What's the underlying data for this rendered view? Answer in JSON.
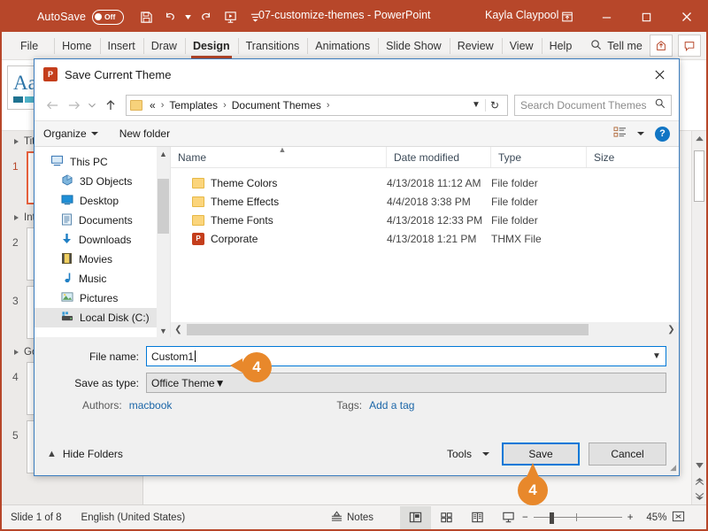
{
  "titlebar": {
    "autosave_label": "AutoSave",
    "autosave_state": "Off",
    "document_title": "07-customize-themes  -  PowerPoint",
    "user_name": "Kayla Claypool",
    "qat_icons": [
      "save-icon",
      "undo-icon",
      "redo-icon",
      "start-presentation-icon",
      "more-commands-icon"
    ],
    "window_buttons": [
      "ribbon-display-options-icon",
      "minimize-icon",
      "maximize-icon",
      "close-icon"
    ],
    "brand_color": "#b7472a"
  },
  "ribbon": {
    "tabs": [
      {
        "label": "File",
        "active": false
      },
      {
        "label": "Home",
        "active": false
      },
      {
        "label": "Insert",
        "active": false
      },
      {
        "label": "Draw",
        "active": false
      },
      {
        "label": "Design",
        "active": true
      },
      {
        "label": "Transitions",
        "active": false
      },
      {
        "label": "Animations",
        "active": false
      },
      {
        "label": "Slide Show",
        "active": false
      },
      {
        "label": "Review",
        "active": false
      },
      {
        "label": "View",
        "active": false
      },
      {
        "label": "Help",
        "active": false
      }
    ],
    "tell_me": "Tell me",
    "right_buttons": [
      "share-icon",
      "comments-icon"
    ],
    "theme_thumb_text": "Aa",
    "theme_thumb_colors": [
      "#1f7391",
      "#4fb3c9",
      "#7ecfcf",
      "#a8e0dc"
    ]
  },
  "slide_panel": {
    "sections": [
      {
        "title": "Title",
        "slides": [
          {
            "number": "1",
            "selected": true
          }
        ]
      },
      {
        "title": "Intro",
        "slides": [
          {
            "number": "2",
            "selected": false
          },
          {
            "number": "3",
            "selected": false
          }
        ]
      },
      {
        "title": "Goals",
        "slides": [
          {
            "number": "4",
            "selected": false
          },
          {
            "number": "5",
            "selected": false
          }
        ]
      }
    ]
  },
  "dialog": {
    "title": "Save Current Theme",
    "app_icon": "powerpoint-icon",
    "close_icon": "close-icon",
    "nav_buttons": [
      "back-icon",
      "forward-icon",
      "recent-locations-icon",
      "up-icon"
    ],
    "address": {
      "crumbs": [
        "«",
        "Templates",
        "Document Themes"
      ],
      "dropdown_icon": "chevron-down-icon",
      "refresh_icon": "refresh-icon"
    },
    "search_placeholder": "Search Document Themes",
    "toolbar": {
      "organize": "Organize",
      "new_folder": "New folder",
      "view_icon": "view-layout-icon",
      "help_label": "?"
    },
    "nav_pane": [
      {
        "label": "This PC",
        "icon": "computer-icon",
        "indent": false,
        "selected": false
      },
      {
        "label": "3D Objects",
        "icon": "3d-objects-icon",
        "indent": true,
        "selected": false
      },
      {
        "label": "Desktop",
        "icon": "desktop-icon",
        "indent": true,
        "selected": false
      },
      {
        "label": "Documents",
        "icon": "documents-icon",
        "indent": true,
        "selected": false
      },
      {
        "label": "Downloads",
        "icon": "downloads-icon",
        "indent": true,
        "selected": false
      },
      {
        "label": "Movies",
        "icon": "movies-icon",
        "indent": true,
        "selected": false
      },
      {
        "label": "Music",
        "icon": "music-icon",
        "indent": true,
        "selected": false
      },
      {
        "label": "Pictures",
        "icon": "pictures-icon",
        "indent": true,
        "selected": false
      },
      {
        "label": "Local Disk (C:)",
        "icon": "disk-icon",
        "indent": true,
        "selected": true
      }
    ],
    "columns": [
      "Name",
      "Date modified",
      "Type",
      "Size"
    ],
    "files": [
      {
        "name": "Theme Colors",
        "date": "4/13/2018 11:12 AM",
        "type": "File folder",
        "size": "",
        "icon": "folder-icon"
      },
      {
        "name": "Theme Effects",
        "date": "4/4/2018 3:38 PM",
        "type": "File folder",
        "size": "",
        "icon": "folder-icon"
      },
      {
        "name": "Theme Fonts",
        "date": "4/13/2018 12:33 PM",
        "type": "File folder",
        "size": "",
        "icon": "folder-icon"
      },
      {
        "name": "Corporate",
        "date": "4/13/2018 1:21 PM",
        "type": "THMX File",
        "size": "",
        "icon": "thmx-file-icon"
      }
    ],
    "fields": {
      "file_name_label": "File name:",
      "file_name_value": "Custom1",
      "save_as_type_label": "Save as type:",
      "save_as_type_value": "Office Theme",
      "authors_label": "Authors:",
      "authors_value": "macbook",
      "tags_label": "Tags:",
      "tags_value": "Add a tag"
    },
    "footer": {
      "hide_folders": "Hide Folders",
      "tools": "Tools",
      "save": "Save",
      "cancel": "Cancel"
    }
  },
  "callouts": [
    {
      "number": "4",
      "position": "file-name-field"
    },
    {
      "number": "4",
      "position": "save-button"
    }
  ],
  "statusbar": {
    "slide_indicator": "Slide 1 of 8",
    "language": "English (United States)",
    "notes": "Notes",
    "views": [
      "normal-view-icon",
      "slide-sorter-icon",
      "reading-view-icon",
      "slide-show-icon"
    ],
    "zoom_out": "−",
    "zoom_in": "+",
    "zoom_level": "45%",
    "fit_icon": "fit-to-window-icon"
  }
}
